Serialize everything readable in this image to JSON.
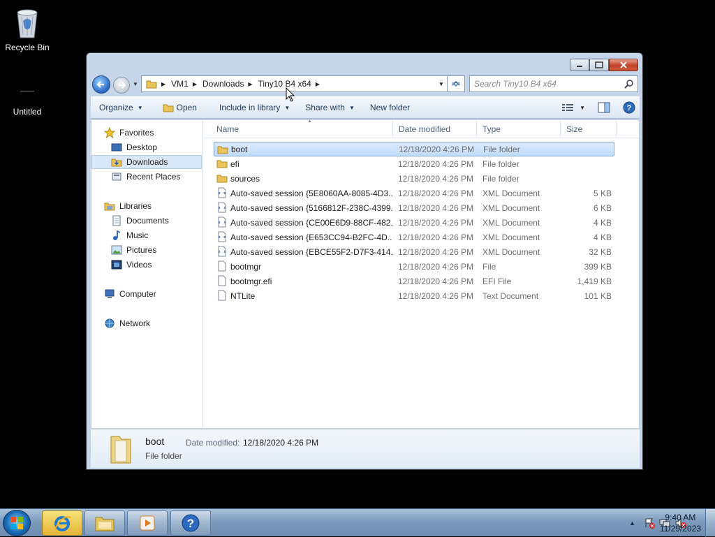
{
  "desktop": {
    "icons": [
      {
        "label": "Recycle Bin"
      },
      {
        "label": "Untitled"
      }
    ]
  },
  "window": {
    "breadcrumb": [
      "VM1",
      "Downloads",
      "Tiny10 B4 x64"
    ],
    "search_placeholder": "Search Tiny10 B4 x64"
  },
  "toolbar": {
    "organize": "Organize",
    "open": "Open",
    "include_in_library": "Include in library",
    "share_with": "Share with",
    "new_folder": "New folder"
  },
  "nav": {
    "favorites": "Favorites",
    "desktop": "Desktop",
    "downloads": "Downloads",
    "recent_places": "Recent Places",
    "libraries": "Libraries",
    "documents": "Documents",
    "music": "Music",
    "pictures": "Pictures",
    "videos": "Videos",
    "computer": "Computer",
    "network": "Network"
  },
  "columns": {
    "name": "Name",
    "date_modified": "Date modified",
    "type": "Type",
    "size": "Size"
  },
  "files": [
    {
      "name": "boot",
      "date": "12/18/2020 4:26 PM",
      "type": "File folder",
      "size": "",
      "icon": "folder-icon"
    },
    {
      "name": "efi",
      "date": "12/18/2020 4:26 PM",
      "type": "File folder",
      "size": "",
      "icon": "folder-icon"
    },
    {
      "name": "sources",
      "date": "12/18/2020 4:26 PM",
      "type": "File folder",
      "size": "",
      "icon": "folder-icon"
    },
    {
      "name": "Auto-saved session {5E8060AA-8085-4D3...",
      "date": "12/18/2020 4:26 PM",
      "type": "XML Document",
      "size": "5 KB",
      "icon": "xml-file-icon"
    },
    {
      "name": "Auto-saved session {5166812F-238C-4399...",
      "date": "12/18/2020 4:26 PM",
      "type": "XML Document",
      "size": "6 KB",
      "icon": "xml-file-icon"
    },
    {
      "name": "Auto-saved session {CE00E6D9-88CF-482...",
      "date": "12/18/2020 4:26 PM",
      "type": "XML Document",
      "size": "4 KB",
      "icon": "xml-file-icon"
    },
    {
      "name": "Auto-saved session {E653CC94-B2FC-4D...",
      "date": "12/18/2020 4:26 PM",
      "type": "XML Document",
      "size": "4 KB",
      "icon": "xml-file-icon"
    },
    {
      "name": "Auto-saved session {EBCE55F2-D7F3-414...",
      "date": "12/18/2020 4:26 PM",
      "type": "XML Document",
      "size": "32 KB",
      "icon": "xml-file-icon"
    },
    {
      "name": "bootmgr",
      "date": "12/18/2020 4:26 PM",
      "type": "File",
      "size": "399 KB",
      "icon": "file-icon"
    },
    {
      "name": "bootmgr.efi",
      "date": "12/18/2020 4:26 PM",
      "type": "EFI File",
      "size": "1,419 KB",
      "icon": "file-icon"
    },
    {
      "name": "NTLite",
      "date": "12/18/2020 4:26 PM",
      "type": "Text Document",
      "size": "101 KB",
      "icon": "file-icon"
    }
  ],
  "details": {
    "name": "boot",
    "date_label": "Date modified:",
    "date_value": "12/18/2020 4:26 PM",
    "type": "File folder"
  },
  "taskbar": {
    "time": "9:40 AM",
    "date": "11/29/2023"
  },
  "colors": {
    "selection": "#cce4fc",
    "accent": "#1e395b"
  }
}
